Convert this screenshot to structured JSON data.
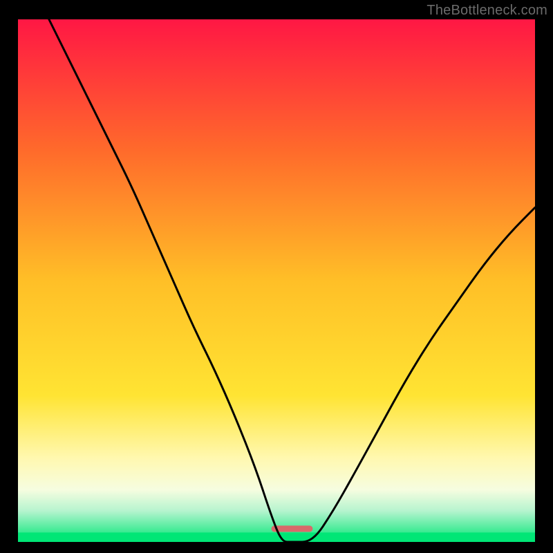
{
  "watermark": "TheBottleneck.com",
  "chart_data": {
    "type": "line",
    "title": "",
    "xlabel": "",
    "ylabel": "",
    "xlim": [
      0,
      100
    ],
    "ylim": [
      0,
      100
    ],
    "grid": false,
    "legend": false,
    "background_gradient": {
      "stops": [
        {
          "offset": 0.0,
          "color": "#ff1744"
        },
        {
          "offset": 0.25,
          "color": "#ff6a2b"
        },
        {
          "offset": 0.5,
          "color": "#ffbf27"
        },
        {
          "offset": 0.72,
          "color": "#ffe433"
        },
        {
          "offset": 0.84,
          "color": "#fff8b0"
        },
        {
          "offset": 0.9,
          "color": "#f6fde0"
        },
        {
          "offset": 0.94,
          "color": "#b7f4cf"
        },
        {
          "offset": 1.0,
          "color": "#00e676"
        }
      ]
    },
    "marker": {
      "color": "#d86a6a",
      "x_range": [
        49,
        57
      ],
      "y": 0,
      "height_pct": 1.2
    },
    "series": [
      {
        "name": "curve",
        "color": "#000000",
        "x": [
          6,
          10,
          14,
          18,
          22,
          26,
          30,
          34,
          38,
          42,
          46,
          49,
          51,
          53,
          57,
          61,
          65,
          70,
          75,
          80,
          85,
          90,
          95,
          100
        ],
        "y": [
          100,
          92,
          84,
          76,
          68,
          59,
          50,
          41,
          33,
          24,
          14,
          5,
          0,
          0,
          0,
          6,
          13,
          22,
          31,
          39,
          46,
          53,
          59,
          64
        ]
      }
    ]
  }
}
